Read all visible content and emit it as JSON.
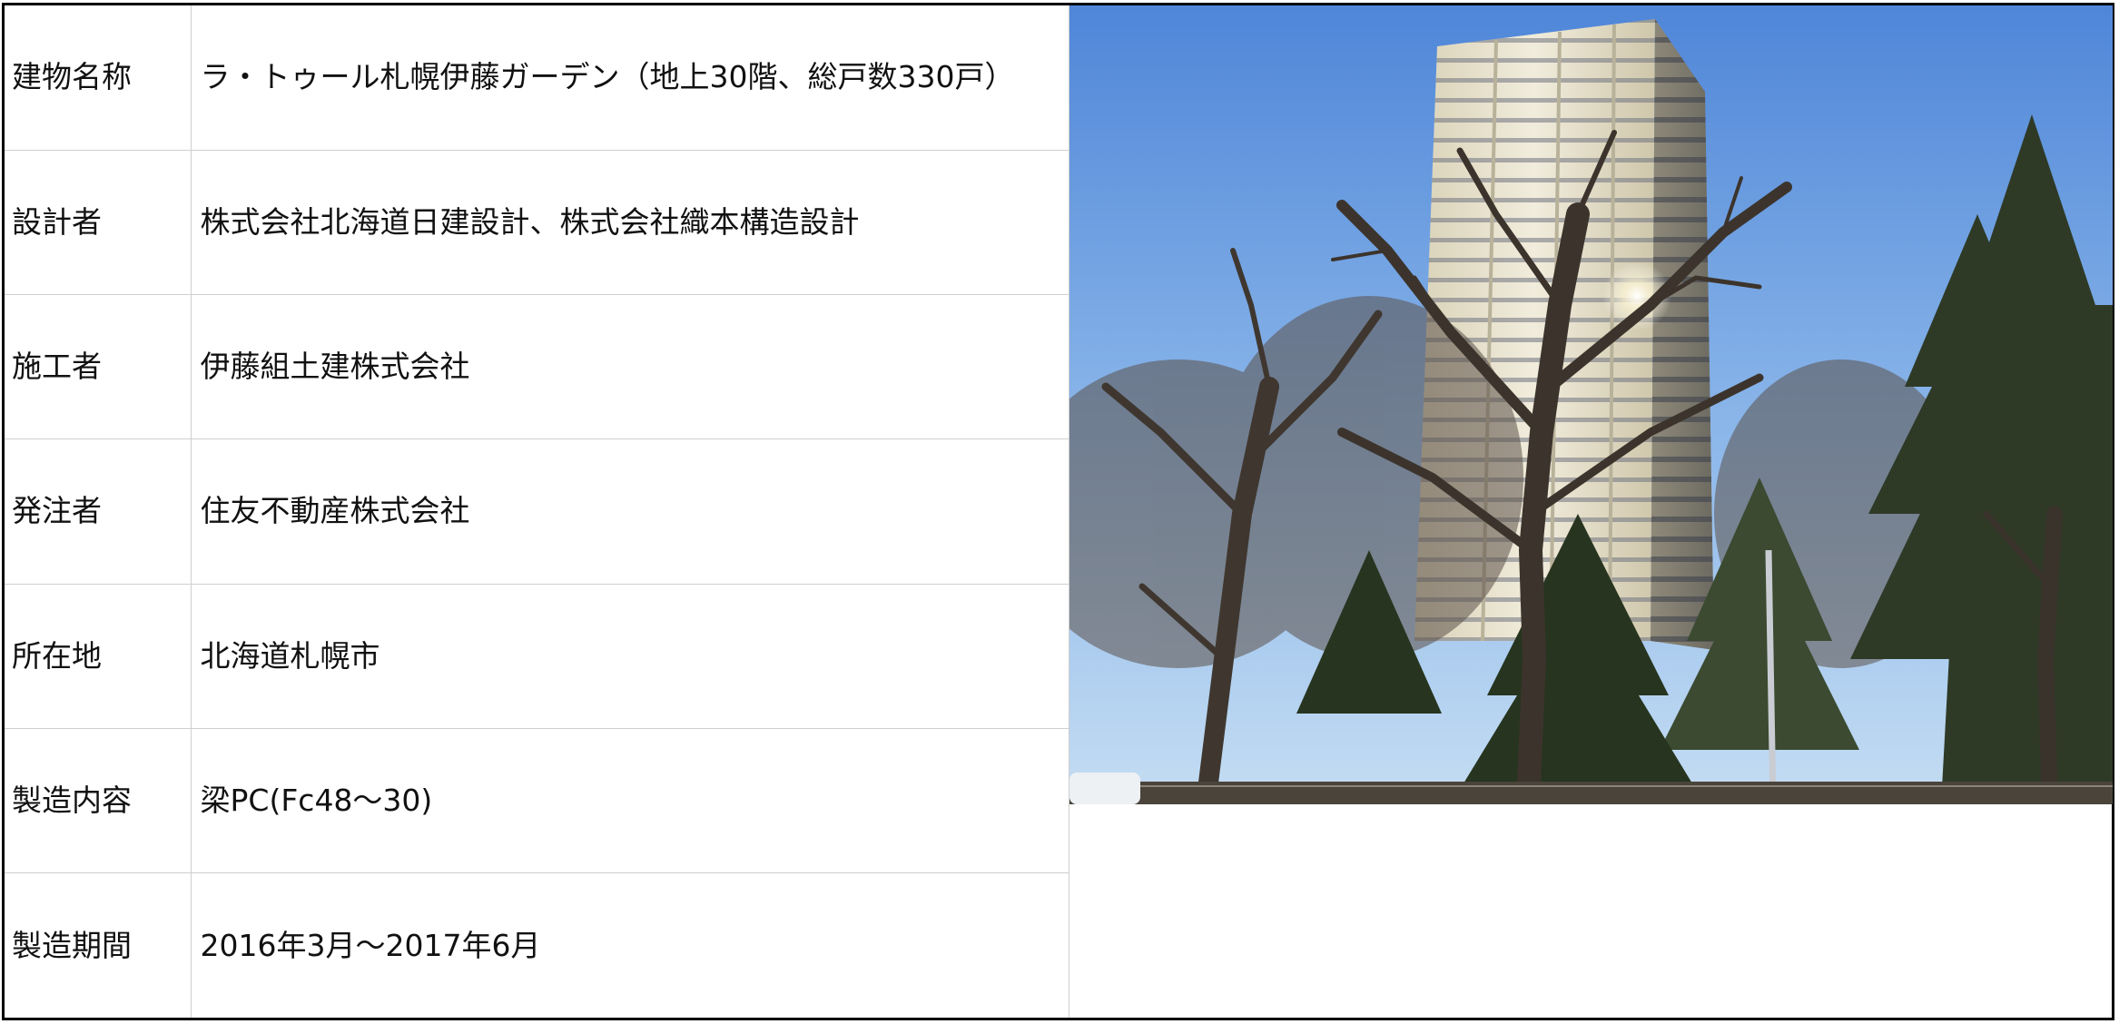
{
  "spec_table": {
    "rows": [
      {
        "label": "建物名称",
        "value": "ラ・トゥール札幌伊藤ガーデン（地上30階、総戸数330戸）"
      },
      {
        "label": "設計者",
        "value": "株式会社北海道日建設計、株式会社織本構造設計"
      },
      {
        "label": "施工者",
        "value": "伊藤組土建株式会社"
      },
      {
        "label": "発注者",
        "value": "住友不動産株式会社"
      },
      {
        "label": "所在地",
        "value": "北海道札幌市"
      },
      {
        "label": "製造内容",
        "value": "梁PC(Fc48～30)"
      },
      {
        "label": "製造期間",
        "value": "2016年3月～2017年6月"
      }
    ]
  },
  "photo": {
    "subject": "tower-building-with-bare-trees",
    "colors": {
      "sky_top": "#4f86d8",
      "sky_bottom": "#c5ddf3",
      "building": "#e9e4d2",
      "trees": "#2e3a26"
    }
  }
}
